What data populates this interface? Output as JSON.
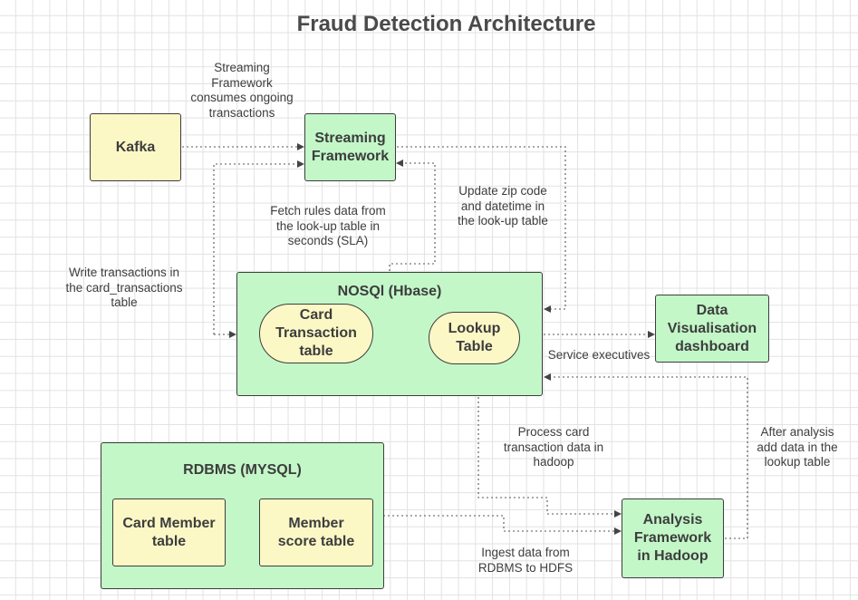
{
  "title": "Fraud Detection Architecture",
  "nodes": {
    "kafka": [
      "Kafka"
    ],
    "streaming": [
      "Streaming",
      "Framework"
    ],
    "nosql": [
      "NOSQl (Hbase)"
    ],
    "card_transaction": [
      "Card",
      "Transaction",
      "table"
    ],
    "lookup": [
      "Lookup",
      "Table"
    ],
    "dataviz": [
      "Data",
      "Visualisation",
      "dashboard"
    ],
    "rdbms": [
      "RDBMS (MYSQL)"
    ],
    "card_member": [
      "Card Member",
      "table"
    ],
    "member_score": [
      "Member",
      "score table"
    ],
    "analysis": [
      "Analysis",
      "Framework",
      "in Hadoop"
    ]
  },
  "notes": {
    "streaming_consumes": [
      "Streaming",
      "Framework",
      "consumes ongoing",
      "transactions"
    ],
    "fetch_rules": [
      "Fetch rules data from",
      "the look-up table in",
      "seconds (SLA)"
    ],
    "update_zip": [
      "Update zip code",
      "and datetime in",
      "the look-up table"
    ],
    "write_transactions": [
      "Write transactions in",
      "the card_transactions",
      "table"
    ],
    "service_executives": [
      "Service executives"
    ],
    "process_card": [
      "Process card",
      "transaction data in",
      "hadoop"
    ],
    "after_analysis": [
      "After analysis",
      "add data in the",
      "lookup table"
    ],
    "ingest": [
      "Ingest data from",
      "RDBMS to HDFS"
    ]
  },
  "colors": {
    "green_fill": "#c3f7c8",
    "yellow_fill": "#fcf8c6",
    "stroke": "#3d3d3d",
    "connector": "#555555",
    "grid": "#e2e2e2"
  }
}
